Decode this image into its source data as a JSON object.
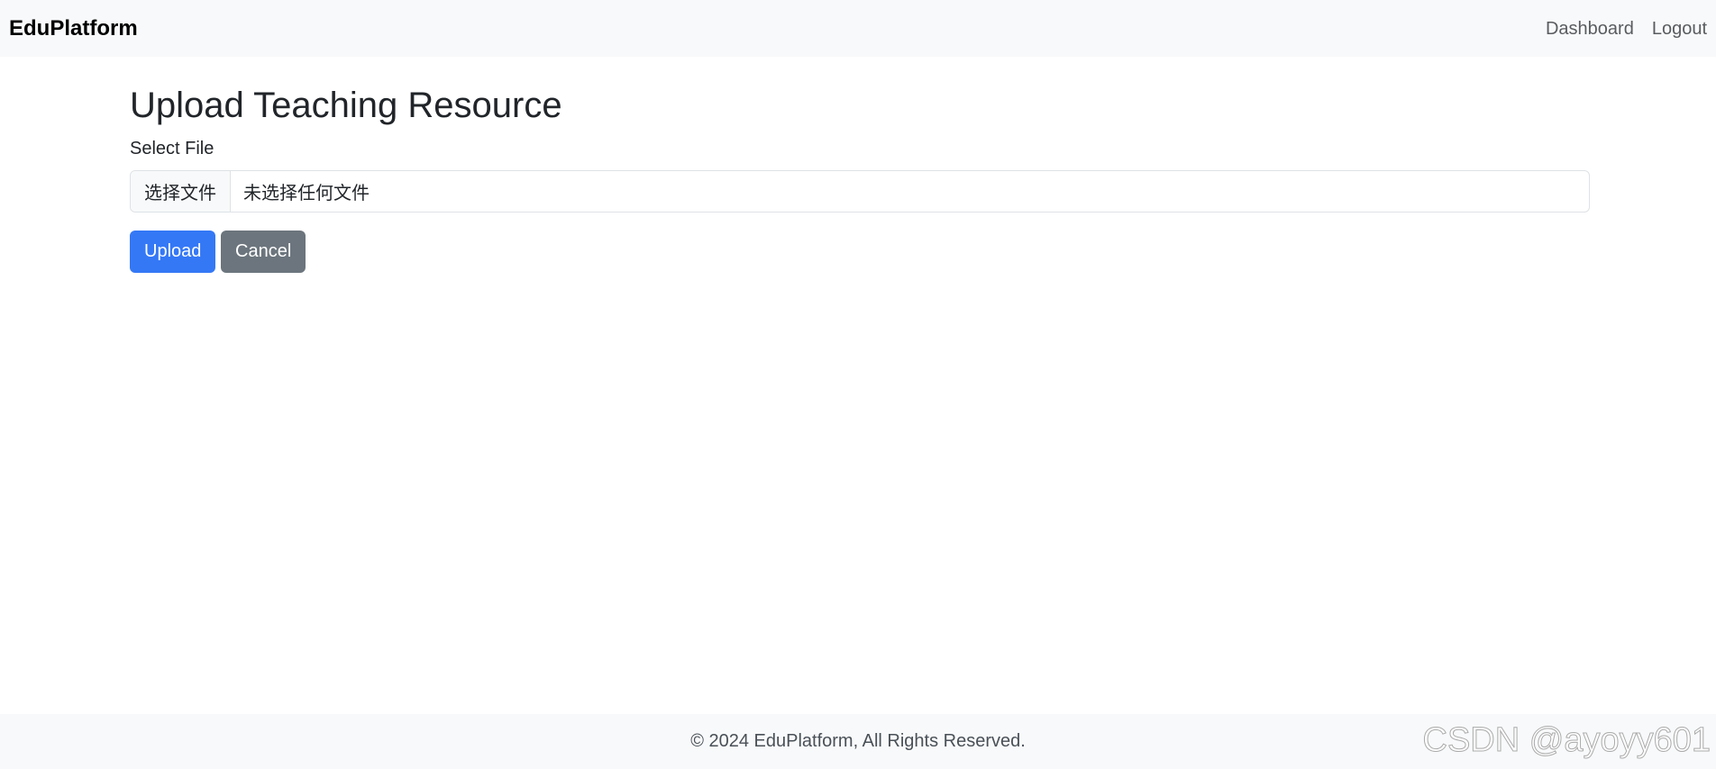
{
  "navbar": {
    "brand": "EduPlatform",
    "links": [
      {
        "label": "Dashboard"
      },
      {
        "label": "Logout"
      }
    ]
  },
  "main": {
    "title": "Upload Teaching Resource",
    "file_label": "Select File",
    "file_button_label": "选择文件",
    "file_status": "未选择任何文件",
    "upload_label": "Upload",
    "cancel_label": "Cancel"
  },
  "footer": {
    "text": "© 2024 EduPlatform, All Rights Reserved."
  },
  "watermark": "CSDN @ayoyy601",
  "colors": {
    "primary": "#3478f6",
    "secondary": "#6c757d",
    "navbar_bg": "#f8f9fa"
  }
}
